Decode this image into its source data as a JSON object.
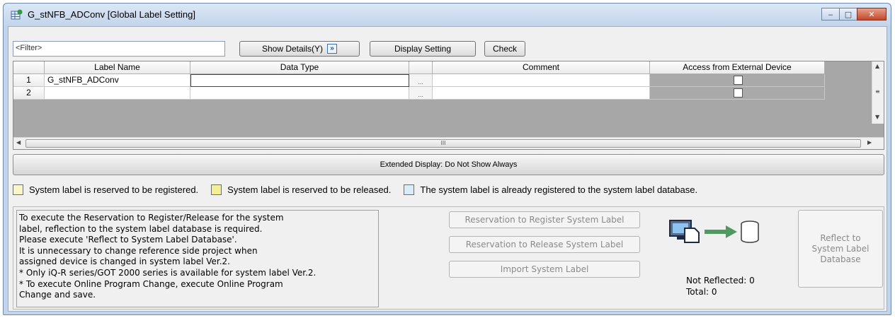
{
  "window": {
    "title": "G_stNFB_ADConv [Global Label Setting]",
    "minimize": "‒",
    "maximize": "□",
    "close": "✕"
  },
  "toolbar": {
    "filter_placeholder": "<Filter>",
    "show_details_label": "Show Details(Y)",
    "show_details_glyph": "»",
    "display_setting_label": "Display Setting",
    "check_label": "Check"
  },
  "grid": {
    "headers": [
      "Label Name",
      "Data Type",
      "",
      "Comment",
      "Access from External Device"
    ],
    "rows": [
      {
        "num": "1",
        "label_name": "G_stNFB_ADConv",
        "data_type": "",
        "ellipsis": "...",
        "comment": "",
        "external_access": false
      },
      {
        "num": "2",
        "label_name": "",
        "data_type": "",
        "ellipsis": "...",
        "comment": "",
        "external_access": false
      }
    ],
    "scroll_thumb_glyph": "III"
  },
  "extended_display_label": "Extended Display: Do Not Show Always",
  "legend": [
    {
      "text": "System label is reserved to be registered.",
      "color": "#f9f7c9"
    },
    {
      "text": "System label is reserved to be released.",
      "color": "#f3ef96"
    },
    {
      "text": "The system label is already registered to the system label database.",
      "color": "#d9ecf7"
    }
  ],
  "info_lines": [
    "To execute the Reservation to Register/Release for the system",
    "label, reflection to the system label database is required.",
    "Please execute 'Reflect to System Label Database'.",
    "It is unnecessary to change reference side project when",
    "assigned device is changed in system label Ver.2.",
    "* Only iQ-R series/GOT 2000 series is available for system label Ver.2.",
    "* To execute Online Program Change, execute Online Program",
    "Change and save."
  ],
  "actions": {
    "register_label": "Reservation to Register System Label",
    "release_label": "Reservation to Release System Label",
    "import_label": "Import System Label",
    "reflect_label_lines": [
      "Reflect to",
      "System Label",
      "Database"
    ]
  },
  "status": {
    "not_reflected": "Not Reflected: 0",
    "total": "Total: 0"
  },
  "colors": {
    "accent": "#4f9a62",
    "window_frame": "#c3d4ea"
  }
}
